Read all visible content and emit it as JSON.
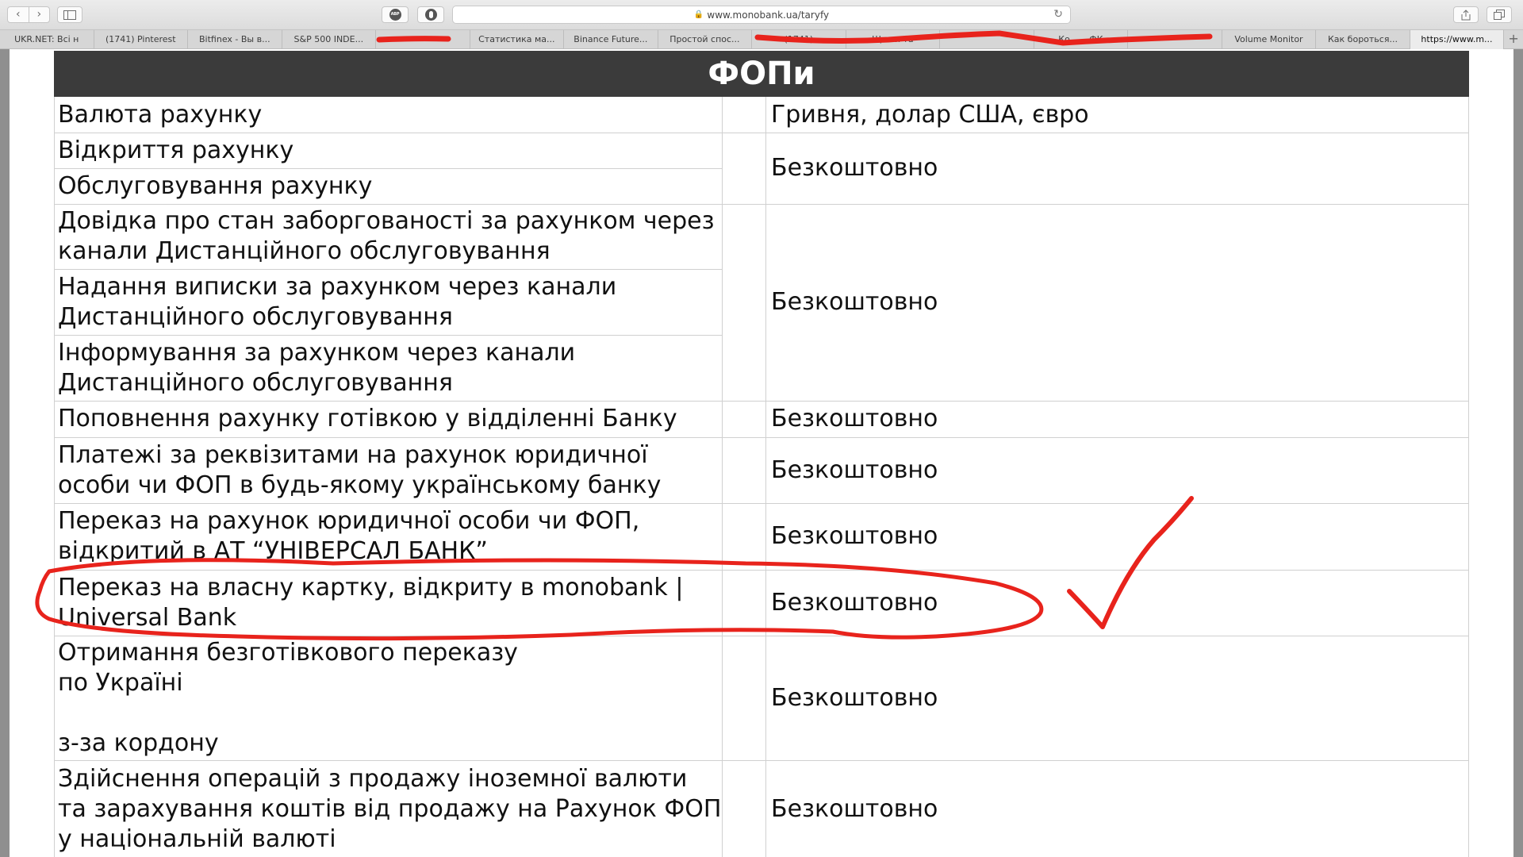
{
  "browser": {
    "url": "www.monobank.ua/taryfy",
    "tabs": [
      "UKR.NET: Всі н",
      "(1741) Pinterest",
      "Bitfinex - Вы в...",
      "S&P 500 INDE...",
      "",
      "Статистика ма...",
      "Binance Future...",
      "Простой спос...",
      "(1741)",
      "Що ви та",
      "",
      "Ко... ...ФК",
      "",
      "Volume Monitor",
      "Как бороться...",
      "https://www.m..."
    ]
  },
  "table": {
    "title": "ФОПи",
    "rows": [
      {
        "label": "Валюта рахунку",
        "value": "Гривня, долар США, євро"
      },
      {
        "label": "Відкриття рахунку"
      },
      {
        "label": "Обслуговування рахунку",
        "value": "Безкоштовно"
      },
      {
        "label": "Довідка про стан заборгованості за рахунком через канали Дистанційного обслуговування"
      },
      {
        "label": "Надання виписки за рахунком через канали Дистанційного обслуговування",
        "value": "Безкоштовно"
      },
      {
        "label": "Інформування за рахунком через канали Дистанційного обслуговування"
      },
      {
        "label": "Поповнення рахунку готівкою у відділенні Банку",
        "value": "Безкоштовно"
      },
      {
        "label": "Платежі за реквізитами на рахунок юридичної особи чи ФОП в будь-якому українському банку",
        "value": "Безкоштовно"
      },
      {
        "label": "Переказ на рахунок юридичної особи чи ФОП, відкритий в АТ “УНІВЕРСАЛ БАНК”",
        "value": "Безкоштовно"
      },
      {
        "label": "Переказ на власну картку, відкриту в monobank | Universal Bank",
        "value": "Безкоштовно"
      },
      {
        "label": "Отримання безготівкового переказу",
        "label2": "по Україні",
        "label3": "з-за кордону",
        "value": "Безкоштовно"
      },
      {
        "label": "Здійснення операцій з продажу іноземної валюти та зарахування коштів від продажу на Рахунок ФОП у національній валюті",
        "value": "Безкоштовно"
      }
    ]
  },
  "colors": {
    "header_bg": "#3b3b3b",
    "annotation": "#e8231c"
  }
}
